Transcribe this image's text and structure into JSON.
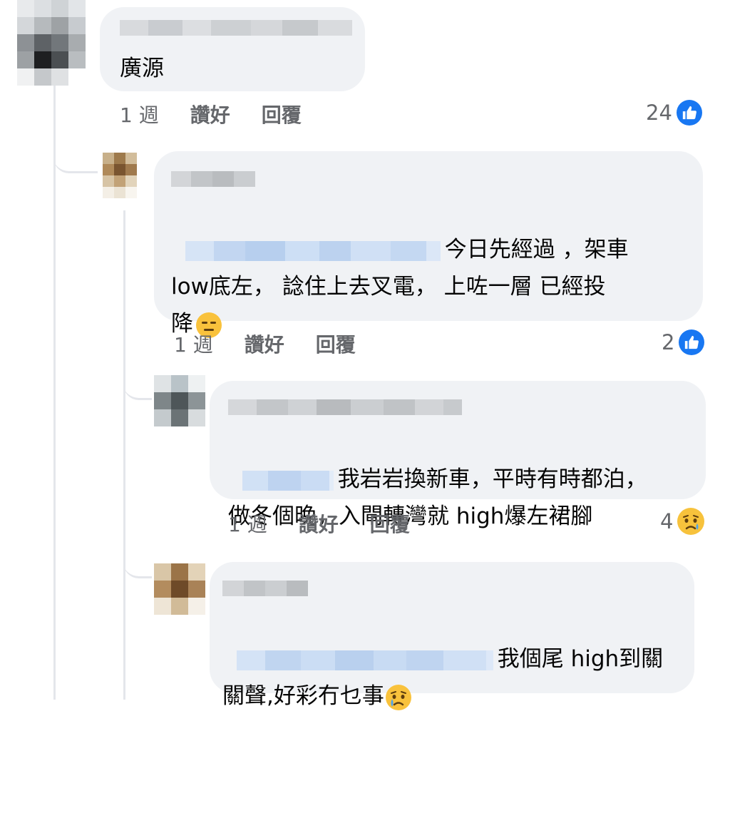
{
  "comments": [
    {
      "text": "廣源",
      "time": "1 週",
      "like_label": "讚好",
      "reply_label": "回覆",
      "reaction_count": "24",
      "reaction_icon": "like-icon"
    },
    {
      "text_line1": "今日先經過 ，架車",
      "text_line2": "low底左， 諗住上去叉電， 上咗一層 已經投",
      "text_line3": "降",
      "emoji": "expressionless-face-icon",
      "time": "1 週",
      "like_label": "讚好",
      "reply_label": "回覆",
      "reaction_count": "2",
      "reaction_icon": "like-icon"
    },
    {
      "text_line1": "我岩岩換新車，平時有時都泊，",
      "text_line2": "做冬個晚，入閘轉灣就 high爆左裙腳",
      "time": "1 週",
      "like_label": "讚好",
      "reply_label": "回覆",
      "reaction_count": "4",
      "reaction_icon": "sad-icon"
    },
    {
      "text_line1": "我個尾 high到關",
      "text_line2": "關聲,好彩冇乜事",
      "emoji": "crying-face-icon"
    }
  ],
  "colors": {
    "bubble": "#f0f2f5",
    "meta_text": "#65676b",
    "like_blue": "#1877f2",
    "thread_line": "#e4e6eb"
  }
}
